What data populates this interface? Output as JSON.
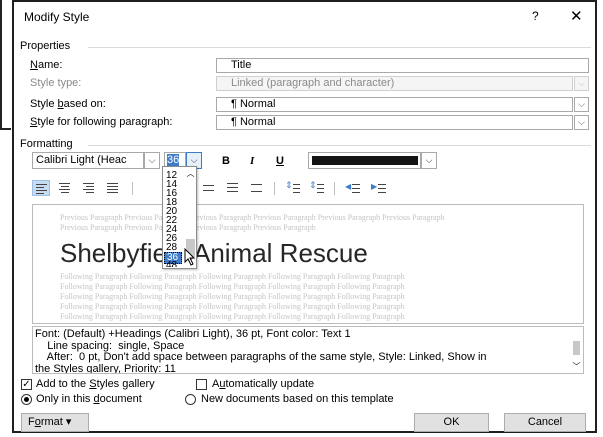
{
  "window": {
    "title": "Modify Style",
    "help": "?",
    "close": "✕"
  },
  "properties": {
    "section": "Properties",
    "name_label_pre": "",
    "name_label_key": "N",
    "name_label_post": "ame:",
    "name_value": "Title",
    "style_type_label": "Style type:",
    "style_type_value": "Linked (paragraph and character)",
    "based_on_label_pre": "Style ",
    "based_on_label_key": "b",
    "based_on_label_post": "ased on:",
    "based_on_value": "¶  Normal",
    "following_label_pre": "",
    "following_label_key": "S",
    "following_label_post": "tyle for following paragraph:",
    "following_value": "¶  Normal"
  },
  "formatting": {
    "section": "Formatting",
    "font": "Calibri Light (Heac",
    "size": "36",
    "bold": "B",
    "italic": "I",
    "underline": "U",
    "color": "#141414"
  },
  "size_options": [
    "12",
    "14",
    "16",
    "18",
    "20",
    "22",
    "24",
    "26",
    "28",
    "36",
    "48",
    "72"
  ],
  "size_selected": "36",
  "preview": {
    "previous_1": "Previous Paragraph Previous Paragraph Previous Paragraph Previous Paragraph Previous Paragraph Previous Paragraph",
    "previous_2": "Previous Paragraph Previous Paragraph Previous Paragraph Previous Paragraph",
    "sample": "Shelbyfield Animal Rescue",
    "following": "Following Paragraph Following Paragraph Following Paragraph Following Paragraph Following Paragraph"
  },
  "description": {
    "line1": "Font: (Default) +Headings (Calibri Light), 36 pt, Font color: Text 1",
    "line2": "    Line spacing:  single, Space",
    "line3": "    After:  0 pt, Don't add space between paragraphs of the same style, Style: Linked, Show in",
    "line4": "the Styles gallery, Priority: 11"
  },
  "options": {
    "add_gallery_pre": "Add to the ",
    "add_gallery_key": "S",
    "add_gallery_post": "tyles gallery",
    "auto_update_pre": "A",
    "auto_update_key": "u",
    "auto_update_post": "tomatically update",
    "only_doc_pre": "Only in this ",
    "only_doc_key": "d",
    "only_doc_post": "ocument",
    "new_docs": "New documents based on this template"
  },
  "buttons": {
    "format_pre": "F",
    "format_key": "o",
    "format_post": "rmat ▾",
    "ok": "OK",
    "cancel": "Cancel"
  }
}
